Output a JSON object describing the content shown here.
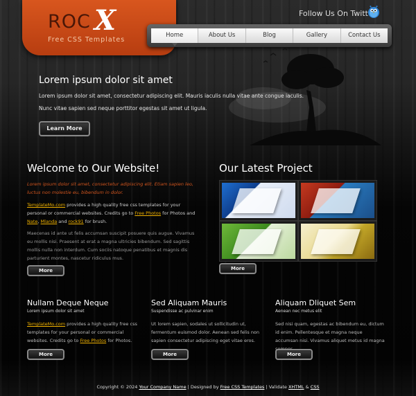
{
  "logo": {
    "roc": "ROC",
    "x": "X",
    "tagline": "Free CSS Templates"
  },
  "twitter": {
    "label": "Follow Us On Twitter"
  },
  "nav": {
    "items": [
      "Home",
      "About Us",
      "Blog",
      "Gallery",
      "Contact Us"
    ],
    "active": "Home"
  },
  "hero": {
    "title": "Lorem ipsum dolor sit amet",
    "p1": "Lorem ipsum dolor sit amet, consectetur adipiscing elit. Mauris iaculis nulla vitae ante congue iaculis.",
    "p2": "Nunc vitae sapien sed neque porttitor egestas sit amet ut ligula.",
    "button": "Learn More"
  },
  "welcome": {
    "title": "Welcome to Our Website!",
    "lead": "Lorem ipsum dolor sit amet, consectetur adipiscing elit. Etiam sapien leo, luctus non molestie eu, bibendum in dolor.",
    "p1_link1": "TemplateMo.com",
    "p1_text1": " provides a high quality free css templates for your personal or commercial websites. Credits go to ",
    "p1_link2": "Free Photos",
    "p1_text2": " for Photos and ",
    "p1_link3": "Nate",
    "p1_text3": ", ",
    "p1_link4": "Mlanda",
    "p1_text4": " and ",
    "p1_link5": "rock91",
    "p1_text5": " for brush.",
    "p2": "Maecenas id ante ut felis accumsan suscipit posuere quis augue. Vivamus eu mollis nisi. Praesent at erat a magna ultricies bibendum. Sed sagittis mollis nulla non interdum. Cum sociis natoque penatibus et magnis dis parturient montes, nascetur ridiculus mus.",
    "button": "More"
  },
  "project": {
    "title": "Our Latest Project",
    "button": "More"
  },
  "columns": [
    {
      "title": "Nullam Deque Neque",
      "sub": "Lorem ipsum dolor sit amet",
      "link1": "TemplateMo.com",
      "text1": " provides a high quality free css templates for your personal or commercial websites. Credits go to ",
      "link2": "Free Photos",
      "text2": " for Photos.",
      "button": "More"
    },
    {
      "title": "Sed Aliquam Mauris",
      "sub": "Suspendisse ac pulvinar enim",
      "text": "Ut lorem sapien, sodales ut sollicitudin ut, fermentum euismod dolor. Aenean sed felis non sapien consectetur adipiscing eget vitae eros.",
      "button": "More"
    },
    {
      "title": "Aliquam Dliquet Sem",
      "sub": "Aenean nec metus elit",
      "text": "Sed nisi quam, egestas ac bibendum eu, dictum id enim. Pellentesque et magna neque accumsan nisi. Vivamus aliquet metus id magna semper.",
      "button": "More"
    }
  ],
  "footer": {
    "copyright": "Copyright © 2024",
    "company": "Your Company Name",
    "sep1": " | Designed by ",
    "designer": "Free CSS Templates",
    "sep2": " | Validate ",
    "xhtml": "XHTML",
    "amp": " & ",
    "css": "CSS"
  },
  "colors": {
    "accent": "#c8461a",
    "link": "#f1b200",
    "lead": "#d2551e"
  }
}
